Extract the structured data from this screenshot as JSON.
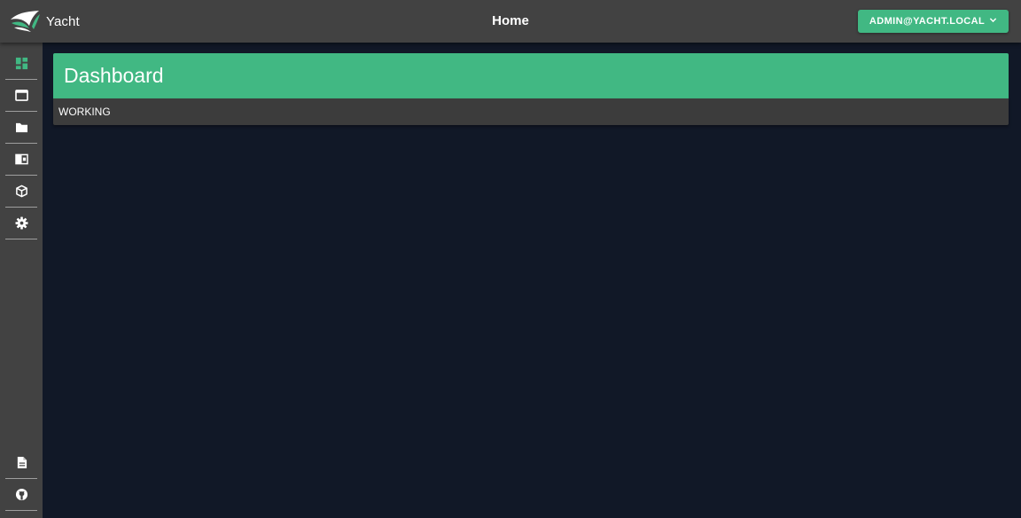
{
  "app": {
    "name": "Yacht",
    "logo_icon": "yacht-sail-logo-icon"
  },
  "header": {
    "title": "Home",
    "user_menu_label": "ADMIN@YACHT.LOCAL",
    "user_menu_icon": "chevron-down-icon"
  },
  "sidebar": {
    "items": [
      {
        "name": "dashboard",
        "icon": "view-dashboard-icon",
        "active": true
      },
      {
        "name": "applications",
        "icon": "application-window-icon",
        "active": false
      },
      {
        "name": "templates",
        "icon": "folder-icon",
        "active": false
      },
      {
        "name": "resources",
        "icon": "card-panel-icon",
        "active": false
      },
      {
        "name": "projects",
        "icon": "cube-icon",
        "active": false
      },
      {
        "name": "settings",
        "icon": "gear-icon",
        "active": false
      }
    ],
    "bottom_items": [
      {
        "name": "docs",
        "icon": "file-document-icon"
      },
      {
        "name": "github",
        "icon": "github-icon"
      }
    ]
  },
  "main": {
    "card_title": "Dashboard",
    "status_text": "WORKING"
  },
  "colors": {
    "accent": "#41b883",
    "bar": "#424242",
    "background": "#111827",
    "text": "#ffffff"
  }
}
